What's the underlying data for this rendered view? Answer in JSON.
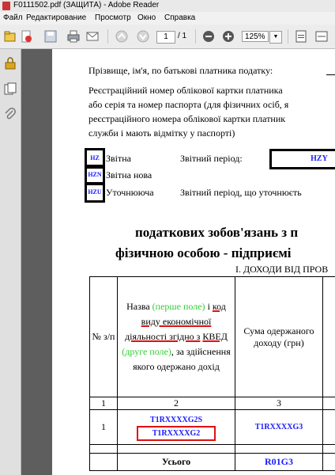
{
  "window": {
    "title": "F0111502.pdf (ЗАЩИТА) - Adobe Reader"
  },
  "menu": [
    "Файл",
    "Редактирование",
    "Просмотр",
    "Окно",
    "Справка"
  ],
  "toolbar": {
    "page_current": "1",
    "page_total": "/ 1",
    "zoom": "125%"
  },
  "document": {
    "taxpayer_name_label": "Прізвище, ім'я, по батькові платника податку:",
    "reg_lines": [
      "Реєстраційний номер облікової картки платника",
      "або серія та номер паспорта (для фізичних осіб, я",
      "реєстраційного номера облікової картки платник",
      "служби і мають відмітку у паспорті)"
    ],
    "report_types": [
      {
        "code": "HZ",
        "label": "Звітна"
      },
      {
        "code": "HZN",
        "label": "Звітна нова"
      },
      {
        "code": "HZU",
        "label": "Уточнююча"
      }
    ],
    "period_label": "Звітний період:",
    "period_value": "HZY",
    "period_clarify_label": "Звітний період, що уточнюєть",
    "heading_line1": "податкових зобов'язань з п",
    "heading_line2": "фізичною особою - підприємі",
    "section_title": "I. ДОХОДИ ВІД ПРОВ",
    "table": {
      "col1_header": "№ з/п",
      "col2_header": {
        "part_a": "Назва ",
        "green1": "(перше поле)",
        "part_b": " і ",
        "u1": "код",
        "u2": "виду економічної",
        "u3": "діяльності згідно з",
        "u4": "КВЕД",
        "green2": " (друге поле)",
        "part_c": ", за здійснення якого одержано дохід"
      },
      "col3_header": "Сума одержаного доходу (грн)",
      "col_numbers": [
        "1",
        "2",
        "3"
      ],
      "row": {
        "num": "1",
        "code_top": "T1RXXXXG2S",
        "code_bottom": "T1RXXXXG2",
        "sum": "T1RXXXXG3"
      },
      "total_label": "Усього",
      "total_value": "R01G3"
    }
  }
}
